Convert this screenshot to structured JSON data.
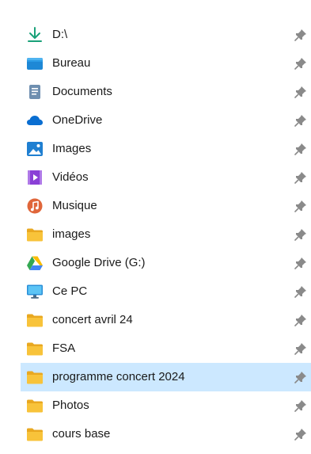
{
  "colors": {
    "selected_background": "#cce8ff",
    "folder_yellow": "#f8c33a",
    "pin_gray": "#8a8a8a"
  },
  "quick_access": {
    "items": [
      {
        "label": "D:\\",
        "icon": "download-arrow-icon",
        "pinned": true,
        "selected": false
      },
      {
        "label": "Bureau",
        "icon": "desktop-folder-icon",
        "pinned": true,
        "selected": false
      },
      {
        "label": "Documents",
        "icon": "documents-icon",
        "pinned": true,
        "selected": false
      },
      {
        "label": "OneDrive",
        "icon": "onedrive-cloud-icon",
        "pinned": true,
        "selected": false
      },
      {
        "label": "Images",
        "icon": "pictures-icon",
        "pinned": true,
        "selected": false
      },
      {
        "label": "Vidéos",
        "icon": "videos-icon",
        "pinned": true,
        "selected": false
      },
      {
        "label": "Musique",
        "icon": "music-icon",
        "pinned": true,
        "selected": false
      },
      {
        "label": "images",
        "icon": "folder-icon",
        "pinned": true,
        "selected": false
      },
      {
        "label": "Google Drive (G:)",
        "icon": "google-drive-icon",
        "pinned": true,
        "selected": false
      },
      {
        "label": "Ce PC",
        "icon": "this-pc-monitor-icon",
        "pinned": true,
        "selected": false
      },
      {
        "label": "concert avril 24",
        "icon": "folder-icon",
        "pinned": true,
        "selected": false
      },
      {
        "label": "FSA",
        "icon": "folder-icon",
        "pinned": true,
        "selected": false
      },
      {
        "label": "programme concert 2024",
        "icon": "folder-icon",
        "pinned": true,
        "selected": true
      },
      {
        "label": "Photos",
        "icon": "folder-icon",
        "pinned": true,
        "selected": false
      },
      {
        "label": "cours base",
        "icon": "folder-icon",
        "pinned": true,
        "selected": false
      }
    ]
  }
}
